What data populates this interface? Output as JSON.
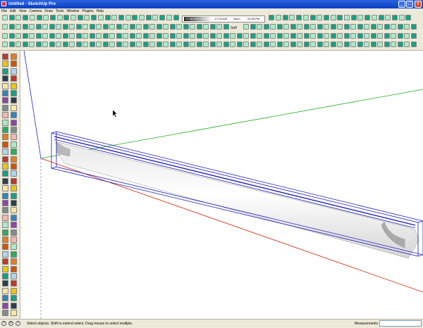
{
  "window": {
    "title": "Untitled - SketchUp Pro"
  },
  "menubar": {
    "items": [
      "File",
      "Edit",
      "View",
      "Camera",
      "Draw",
      "Tools",
      "Window",
      "Plugins",
      "Help"
    ]
  },
  "shadow_widget": {
    "months": "J F M A M J J A S O N D",
    "time_start": "07:00 AM",
    "noon": "Noon",
    "time_end": "04:30 PM"
  },
  "style_toolbar": {
    "soft_label": "Soft"
  },
  "status": {
    "prompt": "Select objects. Shift to extend select. Drag mouse to select multiple.",
    "measurements_label": "Measurements",
    "measurements_value": ""
  },
  "colors": {
    "x_axis": "#cc2200",
    "y_axis": "#22aa22",
    "z_axis": "#2222cc",
    "selection": "#1a1ab8",
    "titlebar": "#1f55d8",
    "chrome": "#ece9d8"
  },
  "icons": [
    "select-arrow-icon",
    "eraser-icon",
    "pencil-icon",
    "rectangle-icon",
    "circle-icon",
    "push-pull-icon",
    "move-icon",
    "rotate-icon",
    "tape-measure-icon",
    "orbit-icon",
    "pan-icon",
    "zoom-icon",
    "zoom-extents-icon",
    "walk-icon",
    "section-plane-icon"
  ]
}
